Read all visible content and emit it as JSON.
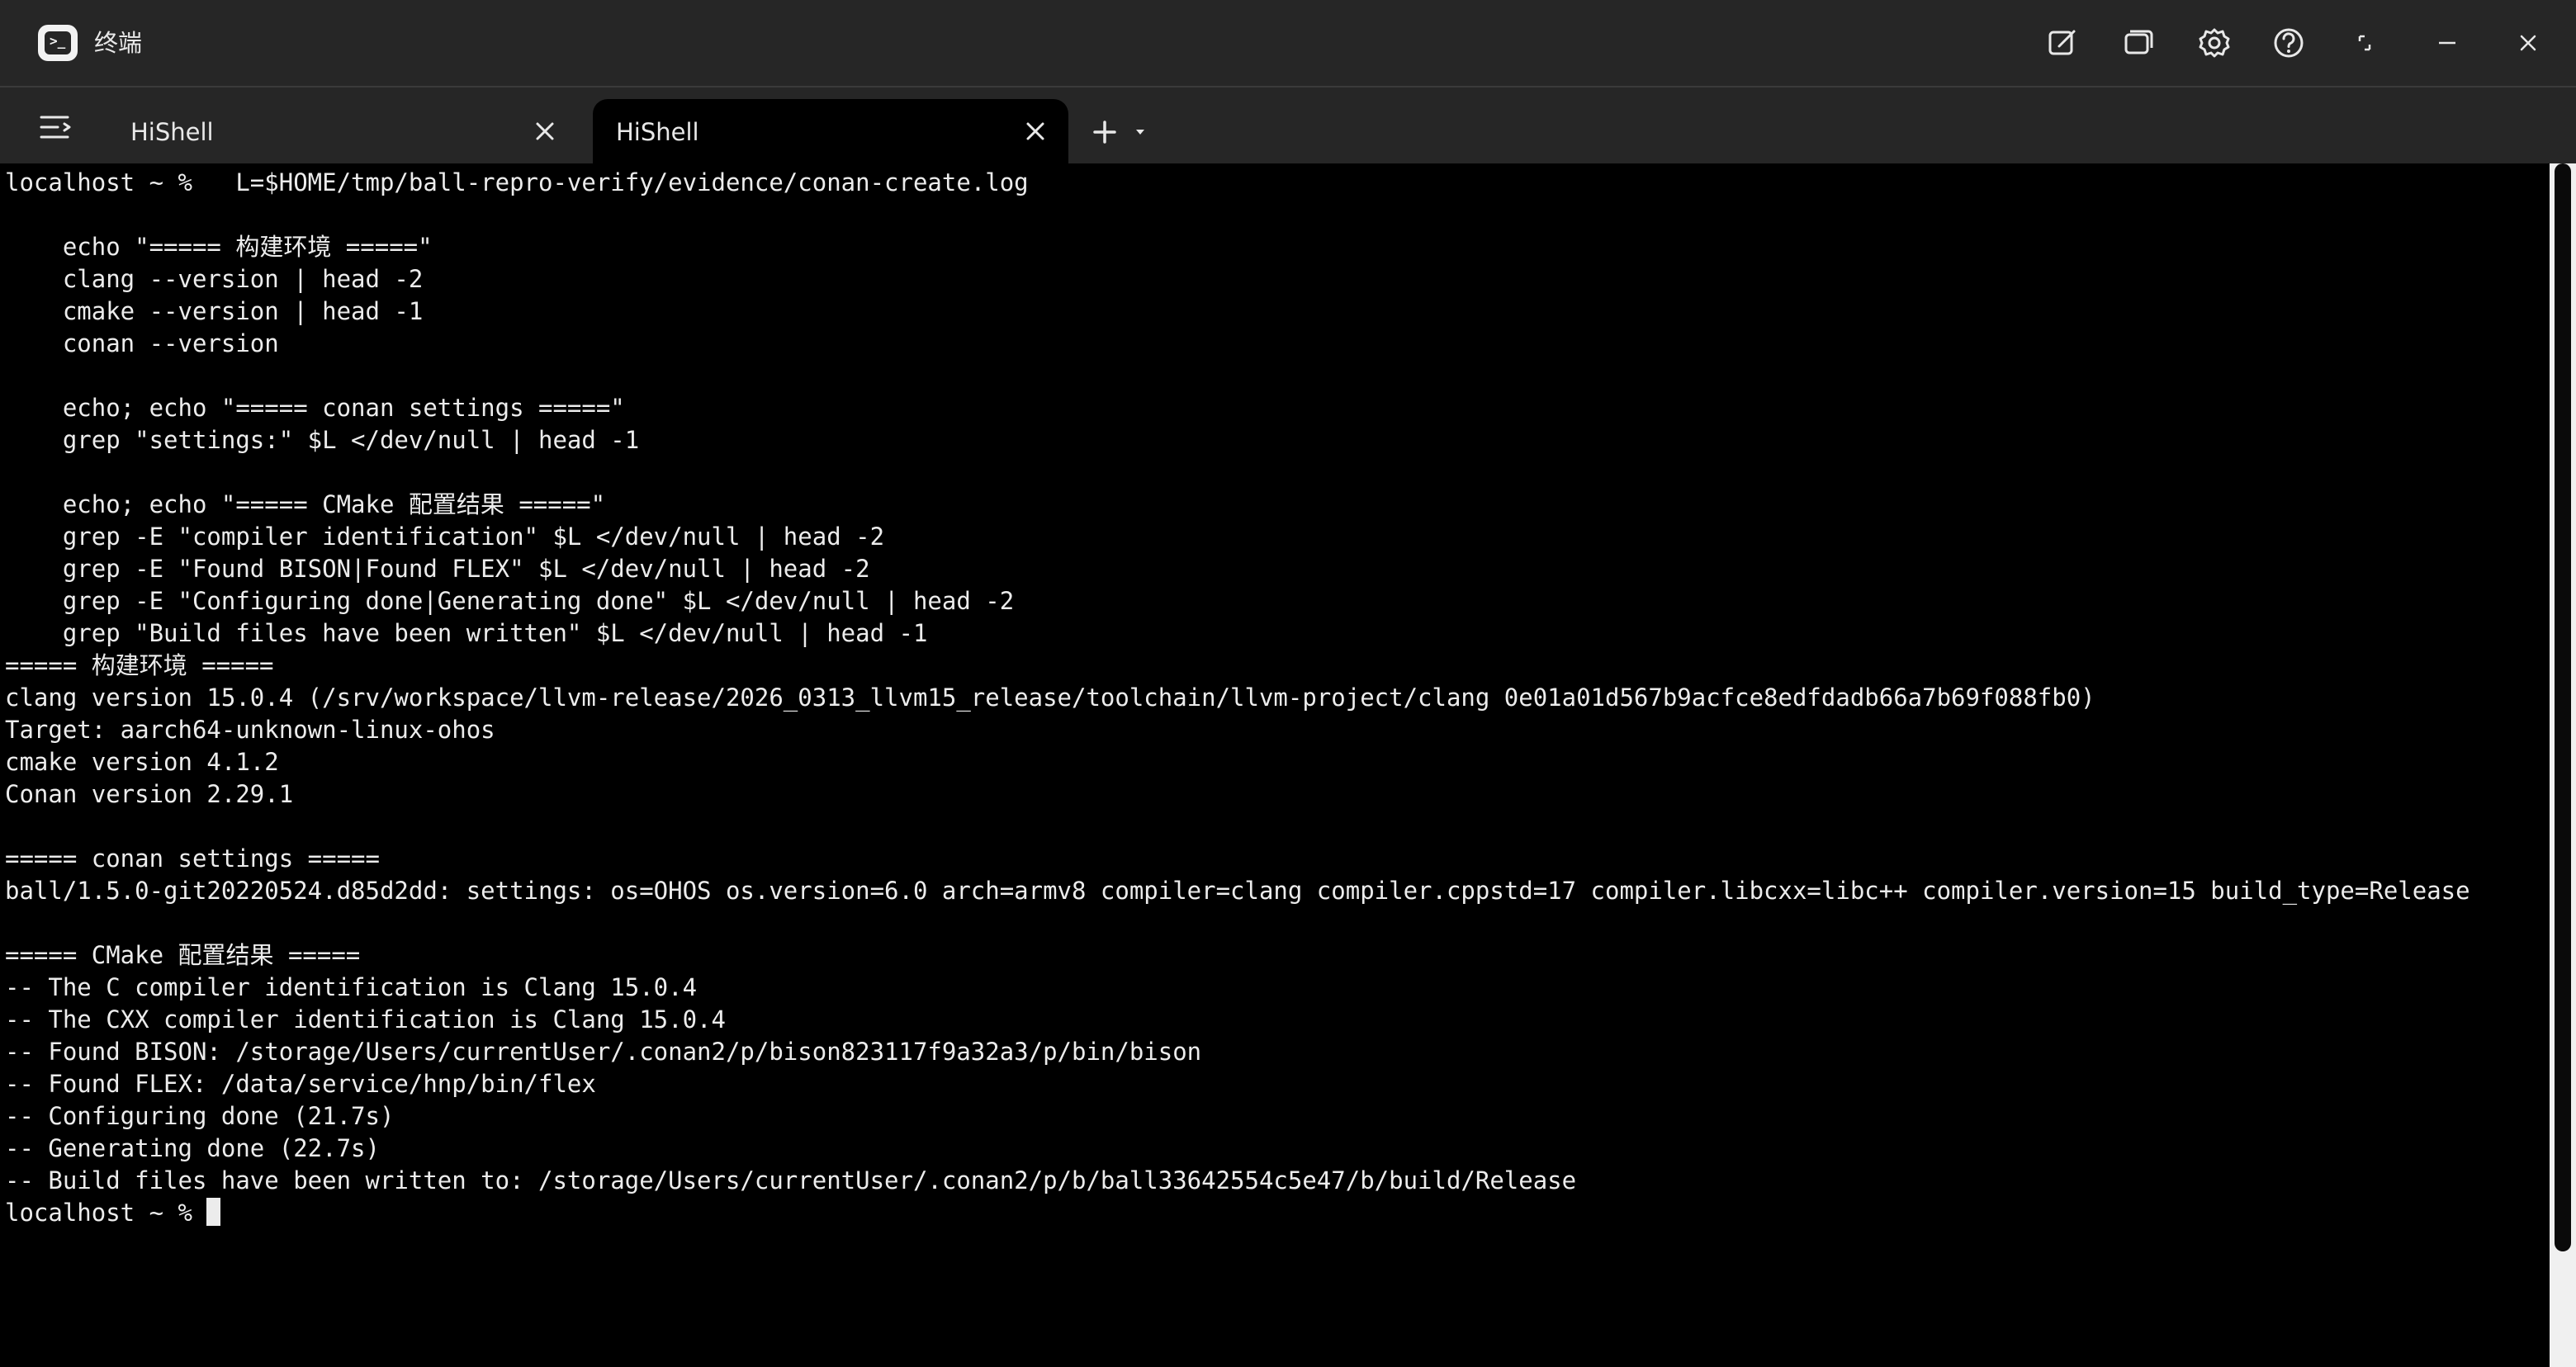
{
  "window": {
    "title": "终端"
  },
  "tabs": [
    {
      "label": "HiShell",
      "active": false
    },
    {
      "label": "HiShell",
      "active": true
    }
  ],
  "titlebar_icons": [
    "new-window-icon",
    "multi-window-icon",
    "settings-gear-icon",
    "help-icon",
    "restore-icon",
    "minimize-icon",
    "close-icon"
  ],
  "terminal": {
    "lines": [
      "localhost ~ %   L=$HOME/tmp/ball-repro-verify/evidence/conan-create.log",
      "",
      "    echo \"===== 构建环境 =====\"",
      "    clang --version | head -2",
      "    cmake --version | head -1",
      "    conan --version",
      "",
      "    echo; echo \"===== conan settings =====\"",
      "    grep \"settings:\" $L </dev/null | head -1",
      "",
      "    echo; echo \"===== CMake 配置结果 =====\"",
      "    grep -E \"compiler identification\" $L </dev/null | head -2",
      "    grep -E \"Found BISON|Found FLEX\" $L </dev/null | head -2",
      "    grep -E \"Configuring done|Generating done\" $L </dev/null | head -2",
      "    grep \"Build files have been written\" $L </dev/null | head -1",
      "===== 构建环境 =====",
      "clang version 15.0.4 (/srv/workspace/llvm-release/2026_0313_llvm15_release/toolchain/llvm-project/clang 0e01a01d567b9acfce8edfdadb66a7b69f088fb0)",
      "Target: aarch64-unknown-linux-ohos",
      "cmake version 4.1.2",
      "Conan version 2.29.1",
      "",
      "===== conan settings =====",
      "ball/1.5.0-git20220524.d85d2dd: settings: os=OHOS os.version=6.0 arch=armv8 compiler=clang compiler.cppstd=17 compiler.libcxx=libc++ compiler.version=15 build_type=Release",
      "",
      "===== CMake 配置结果 =====",
      "-- The C compiler identification is Clang 15.0.4",
      "-- The CXX compiler identification is Clang 15.0.4",
      "-- Found BISON: /storage/Users/currentUser/.conan2/p/bison823117f9a32a3/p/bin/bison",
      "-- Found FLEX: /data/service/hnp/bin/flex",
      "-- Configuring done (21.7s)",
      "-- Generating done (22.7s)",
      "-- Build files have been written to: /storage/Users/currentUser/.conan2/p/b/ball33642554c5e47/b/build/Release"
    ],
    "prompt": "localhost ~ % "
  }
}
